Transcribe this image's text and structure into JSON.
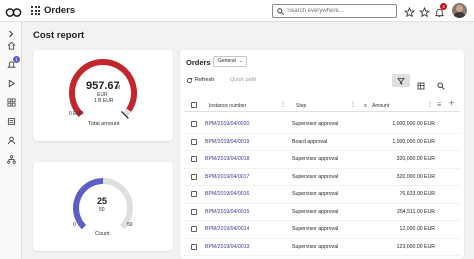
{
  "app": {
    "title": "Orders",
    "search_placeholder": "Search everywhere...",
    "notifications_count": "4"
  },
  "rail": {
    "notifications_count": "1"
  },
  "page": {
    "title": "Cost report"
  },
  "total_gauge": {
    "value": "957.67",
    "unit_suffix": "M",
    "currency": "EUR",
    "max_label": "1 B EUR",
    "min_label": "0 EUR",
    "caption": "Total amount",
    "fill_fraction": 0.958,
    "color": "#c4262e"
  },
  "count_gauge": {
    "value": "25",
    "max_label": "50",
    "min_label": "0",
    "end_label": "50",
    "caption": "Count",
    "fill_fraction": 0.5,
    "color": "#5b5fc7"
  },
  "orders": {
    "title": "Orders",
    "view_select": "General",
    "refresh_label": "Refresh",
    "quick_path_label": "Quick path",
    "columns": {
      "instance": "Instance number",
      "step": "Step",
      "amount": "Amount"
    },
    "rows": [
      {
        "instance": "BPM/2019/04/0020",
        "step": "Supervisor approval",
        "amount": "1,000,000.00 EUR"
      },
      {
        "instance": "BPM/2019/04/0019",
        "step": "Board approval",
        "amount": "1,000,000.00 EUR"
      },
      {
        "instance": "BPM/2019/04/0018",
        "step": "Supervisor approval",
        "amount": "320,000.00 EUR"
      },
      {
        "instance": "BPM/2019/04/0017",
        "step": "Supervisor approval",
        "amount": "320,000.00 EUR"
      },
      {
        "instance": "BPM/2019/04/0016",
        "step": "Supervisor approval",
        "amount": "76,633.00 EUR"
      },
      {
        "instance": "BPM/2019/04/0015",
        "step": "Supervisor approval",
        "amount": "254,511.00 EUR"
      },
      {
        "instance": "BPM/2019/04/0014",
        "step": "Supervisor approval",
        "amount": "12,000.00 EUR"
      },
      {
        "instance": "BPM/2019/04/0013",
        "step": "Supervisor approval",
        "amount": "123,000.00 EUR"
      }
    ]
  }
}
